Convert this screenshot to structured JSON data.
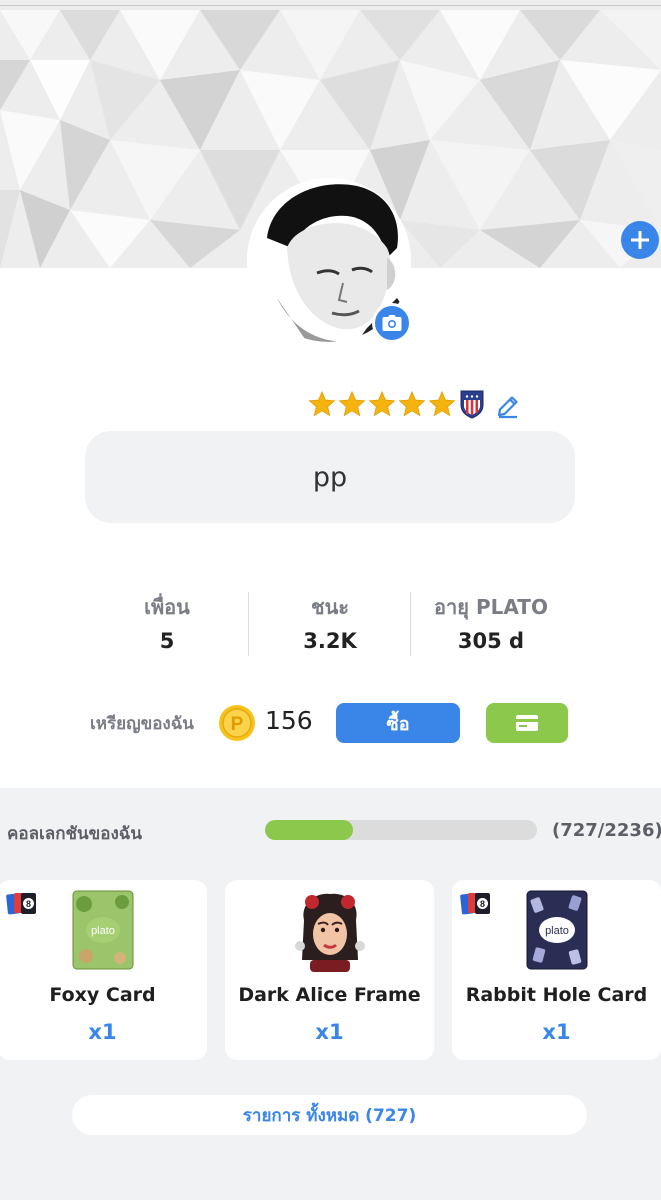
{
  "header": {
    "add_icon": "plus-icon",
    "camera_icon": "camera-icon"
  },
  "profile": {
    "name": "pp",
    "stars": 5,
    "badge_icon": "shield-badge-icon",
    "edit_icon": "pencil-icon"
  },
  "stats": [
    {
      "label": "เพื่อน",
      "value": "5"
    },
    {
      "label": "ชนะ",
      "value": "3.2K"
    },
    {
      "label": "อายุ PLATO",
      "value": "305 d"
    }
  ],
  "coins": {
    "label": "เหรียญของฉัน",
    "value": "156",
    "buy_label": "ซื้อ",
    "wallet_icon": "wallet-icon"
  },
  "collection": {
    "title": "คอลเลกชันของฉัน",
    "count_text": "(727/2236)",
    "owned": 727,
    "total": 2236,
    "items": [
      {
        "name": "Foxy Card",
        "qty": "x1",
        "image_text": "plato"
      },
      {
        "name": "Dark Alice Frame",
        "qty": "x1"
      },
      {
        "name": "Rabbit Hole Card",
        "qty": "x1",
        "image_text": "plato"
      }
    ],
    "all_label": "รายการ ทั้งหมด (727)"
  },
  "colors": {
    "accent_blue": "#3a86e8",
    "accent_green": "#8cc84b",
    "star_gold": "#f4b30f"
  }
}
